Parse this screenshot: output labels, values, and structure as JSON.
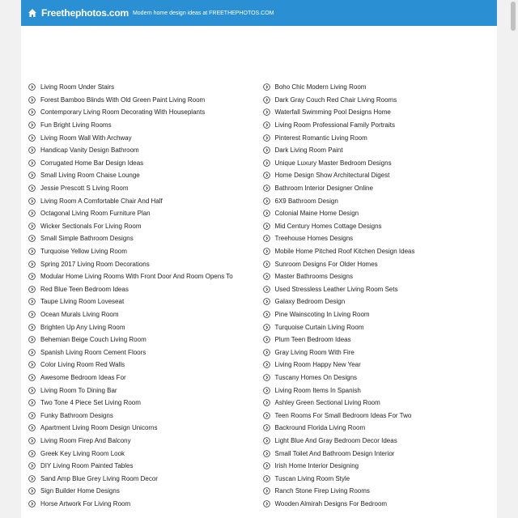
{
  "header": {
    "site_name": "Freethephotos.com",
    "tagline": "Modern home design ideas at FREETHEPHOTOS.COM",
    "bg_color": "#2a8fd3"
  },
  "links_left": [
    "Living Room Under Stairs",
    "Forest Bamboo Blinds With Old Green Paint Living Room",
    "Contemporary Living Room Decorating With Houseplants",
    "Fun Bright Living Rooms",
    "Living Room Wall With Archway",
    "Handicap Vanity Design Bathroom",
    "Corrugated Home Bar Design Ideas",
    "Small Living Room Chaise Lounge",
    "Jessie Prescott S Living Room",
    "Living Room A Comfortable Chair And Half",
    "Octagonal Living Room Furniture Plan",
    "Wicker Sectionals For Living Room",
    "Small Simple Bathroom Designs",
    "Turquoise Yellow Living Room",
    "Spring 2017 Living Room Decorations",
    "Modular Home Living Rooms With Front Door And Room Opens To",
    "Red Blue Teen Bedroom Ideas",
    "Taupe Living Room Loveseat",
    "Ocean Murals Living Room",
    "Brighten Up Any Living Room",
    "Behemian Beige Couch Living Room",
    "Spanish Living Room Cement Floors",
    "Color Living Room Red Walls",
    "Awesome Bedroom Ideas For",
    "Living Room To Dining Bar",
    "Two Tone 4 Piece Set Living Room",
    "Funky Bathroom Designs",
    "Apartment Living Room Design Unicorns",
    "Living Room Firep And Balcony",
    "Greek Key Living Room Look",
    "DIY Living Room Painted Tables",
    "Sand Amp Blue Grey Living Room Decor",
    "Sign Builder Home Designs",
    "Horse Artwork For Living Room"
  ],
  "links_right": [
    "Boho Chic Modern Living Room",
    "Dark Gray Couch Red Chair Living Rooms",
    "Waterfall Swimming Pool Designs Home",
    "Living Room Professional Family Portraits",
    "Pinterest Romantic Living Room",
    "Dark Living Room Paint",
    "Unique Luxury Master Bedroom Designs",
    "Home Design Show Architectural Digest",
    "Bathroom Interior Designer Online",
    "6X9 Bathroom Design",
    "Colonial Maine Home Design",
    "Mid Century Homes Cottage Designs",
    "Treehouse Homes Designs",
    "Mobile Home Pitched Roof Kitchen Design Ideas",
    "Sunroom Designs For Older Homes",
    "Master Bathrooms Designs",
    "Used Stressless Leather Living Room Sets",
    "Galaxy Bedroom Design",
    "Pine Wainscoting In Living Room",
    "Turquoise Curtain Living Room",
    "Plum Teen Bedroom Ideas",
    "Gray Living Room With Fire",
    "Living Room Happy New Year",
    "Tuscany Homes On Designs",
    "Living Room Items In Spanish",
    "Ashley Green Sectional Living Room",
    "Teen Rooms For Small Bedroom Ideas For Two",
    "Backround Florida Living Room",
    "Light Blue And Gray Bedroom Decor Ideas",
    "Small Toilet And Bathroom Design Interior",
    "Irish Home Interior Designing",
    "Tuscan Living Room Style",
    "Ranch Stone Firep Living Rooms",
    "Wooden Almirah Designs For Bedroom"
  ]
}
